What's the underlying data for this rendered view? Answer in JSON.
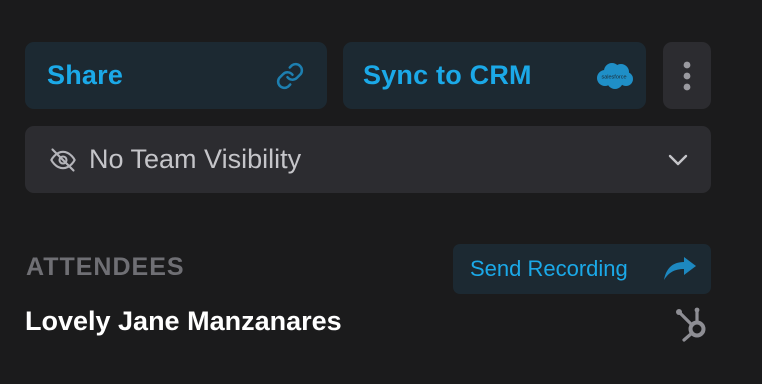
{
  "actions": {
    "share_label": "Share",
    "sync_label": "Sync to CRM",
    "crm_logo_text": "salesforce",
    "share_icon": "link-icon",
    "more_icon": "vertical-dots-icon"
  },
  "visibility": {
    "label": "No Team Visibility",
    "icon": "eye-off-icon",
    "caret_icon": "chevron-down-icon"
  },
  "attendees": {
    "section_label": "ATTENDEES",
    "send_recording_label": "Send Recording",
    "send_icon": "share-arrow-icon",
    "items": [
      {
        "name": "Lovely Jane Manzanares",
        "crm_icon": "hubspot-icon"
      }
    ]
  },
  "colors": {
    "background": "#1b1b1c",
    "accent": "#1ba9e8",
    "button_bg": "#1c2932",
    "secondary_bg": "#2c2c30"
  }
}
